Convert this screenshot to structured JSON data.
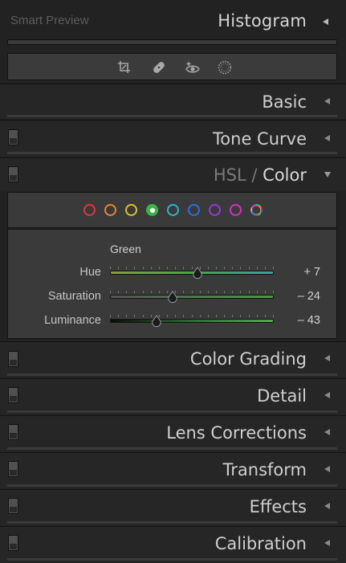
{
  "histogram": {
    "smart_preview": "Smart Preview",
    "title": "Histogram"
  },
  "tools": [
    {
      "icon": "crop-icon"
    },
    {
      "icon": "healing-icon"
    },
    {
      "icon": "red-eye-icon"
    },
    {
      "icon": "masking-icon"
    }
  ],
  "panels": {
    "basic": "Basic",
    "tone_curve": "Tone Curve",
    "hsl": "HSL",
    "hsl_sep": "/",
    "color": "Color",
    "color_grading": "Color Grading",
    "detail": "Detail",
    "lens_corrections": "Lens Corrections",
    "transform": "Transform",
    "effects": "Effects",
    "calibration": "Calibration"
  },
  "swatches": [
    {
      "name": "red",
      "color": "#e0353a"
    },
    {
      "name": "orange",
      "color": "#e8852a"
    },
    {
      "name": "yellow",
      "color": "#d9c22a"
    },
    {
      "name": "green",
      "color": "#3bb34a",
      "selected": true
    },
    {
      "name": "aqua",
      "color": "#2ab5c8"
    },
    {
      "name": "blue",
      "color": "#2b6fd9"
    },
    {
      "name": "purple",
      "color": "#9a36d6"
    },
    {
      "name": "magenta",
      "color": "#cf33c2"
    },
    {
      "name": "all",
      "color": "multi"
    }
  ],
  "hsl_channel": "Green",
  "sliders": [
    {
      "label": "Hue",
      "value": "+ 7",
      "position": 0.535
    },
    {
      "label": "Saturation",
      "value": "– 24",
      "position": 0.38
    },
    {
      "label": "Luminance",
      "value": "– 43",
      "position": 0.285
    }
  ]
}
